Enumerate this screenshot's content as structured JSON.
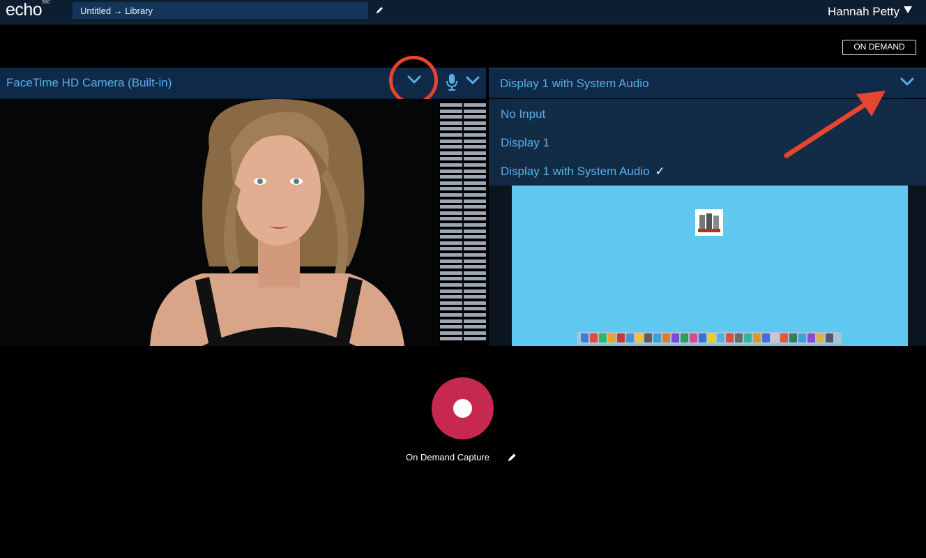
{
  "app": {
    "logo": "echo",
    "logo_sup": "360"
  },
  "header": {
    "title_path": "Untitled → Library",
    "user_name": "Hannah Petty"
  },
  "mode_badge": "ON DEMAND",
  "camera": {
    "source_label": "FaceTime HD Camera (Built-in)"
  },
  "display": {
    "source_label": "Display 1 with System Audio",
    "options": [
      {
        "label": "No Input",
        "selected": false
      },
      {
        "label": "Display 1",
        "selected": false
      },
      {
        "label": "Display 1 with System Audio",
        "selected": true
      }
    ],
    "check_glyph": "✓"
  },
  "capture": {
    "name": "On Demand Capture"
  },
  "colors": {
    "accent_blue": "#5aaee8",
    "record_red": "#c7284f",
    "highlight_orange": "#e64531",
    "header_bg": "#0d1e31"
  },
  "icons": [
    "edit-icon",
    "caret-down-icon",
    "chevron-down-icon",
    "microphone-icon",
    "record-icon",
    "arrow-icon"
  ]
}
